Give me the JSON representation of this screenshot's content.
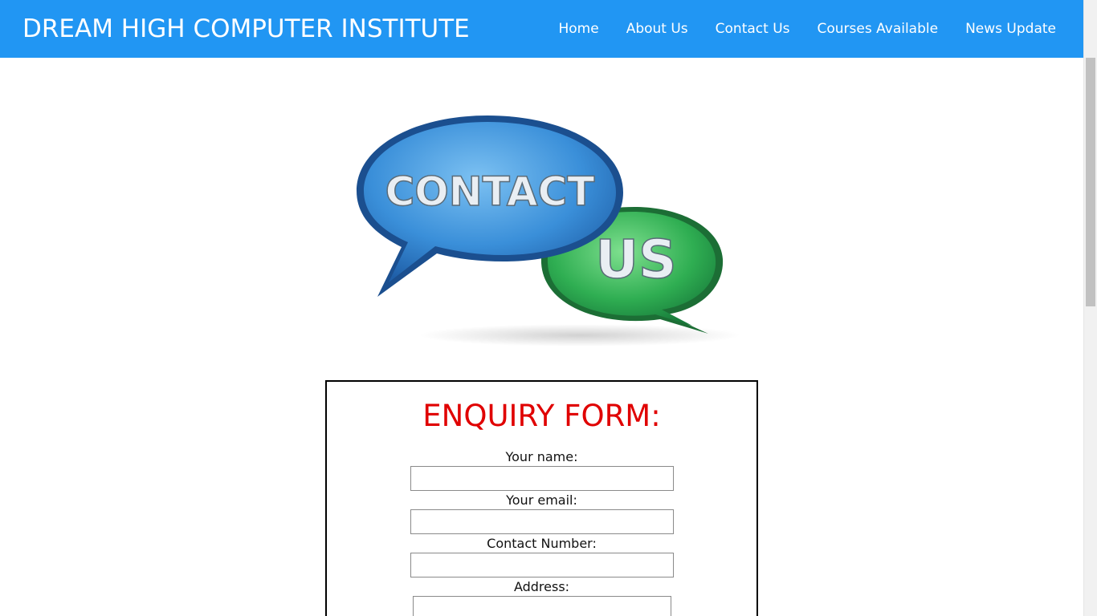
{
  "header": {
    "brand": "DREAM HIGH COMPUTER INSTITUTE",
    "background_color": "#2196f3",
    "nav": [
      {
        "label": "Home"
      },
      {
        "label": "About Us"
      },
      {
        "label": "Contact Us"
      },
      {
        "label": "Courses Available"
      },
      {
        "label": "News Update"
      }
    ]
  },
  "hero": {
    "bubble_large_text": "CONTACT",
    "bubble_small_text": "US",
    "bubble_large_color": "#3a8fd9",
    "bubble_small_color": "#2fae52"
  },
  "enquiry": {
    "title": "ENQUIRY FORM:",
    "title_color": "#e00000",
    "fields": [
      {
        "label": "Your name:",
        "value": ""
      },
      {
        "label": "Your email:",
        "value": ""
      },
      {
        "label": "Contact Number:",
        "value": ""
      },
      {
        "label": "Address:",
        "value": ""
      }
    ]
  }
}
